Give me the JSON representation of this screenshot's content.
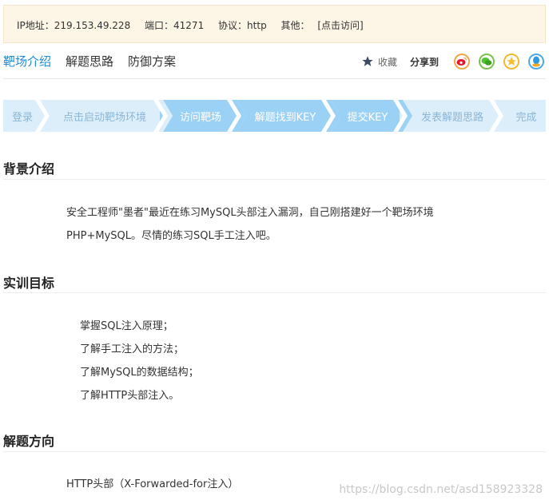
{
  "info": {
    "ip_label": "IP地址：219.153.49.228",
    "port_label": "端口：41271",
    "protocol_label": "协议：http",
    "other_label": "其他：",
    "link_label": "[点击访问]"
  },
  "tabs": [
    {
      "label": "靶场介绍"
    },
    {
      "label": "解题思路"
    },
    {
      "label": "防御方案"
    }
  ],
  "share": {
    "fav_label": "收藏",
    "share_label": "分享到"
  },
  "steps": [
    {
      "label": "登录"
    },
    {
      "label": "点击启动靶场环境"
    },
    {
      "label": "访问靶场"
    },
    {
      "label": "解题找到KEY"
    },
    {
      "label": "提交KEY"
    },
    {
      "label": "发表解题思路"
    },
    {
      "label": "完成"
    }
  ],
  "sections": {
    "background": {
      "title": "背景介绍",
      "lines": [
        "安全工程师\"墨者\"最近在练习MySQL头部注入漏洞，自己刚搭建好一个靶场环境",
        "PHP+MySQL。尽情的练习SQL手工注入吧。"
      ]
    },
    "goals": {
      "title": "实训目标",
      "lines": [
        "掌握SQL注入原理；",
        "了解手工注入的方法；",
        "了解MySQL的数据结构；",
        "了解HTTP头部注入。"
      ]
    },
    "direction": {
      "title": "解题方向",
      "lines": [
        "HTTP头部（X-Forwarded-for注入）"
      ]
    }
  },
  "watermark": "https://blog.csdn.net/asd158923328",
  "colors": {
    "accent": "#1f8bd8",
    "info_bg": "#fdf5e6",
    "step_current": "#9cd1f6",
    "step_inactive": "#ddeefb"
  }
}
